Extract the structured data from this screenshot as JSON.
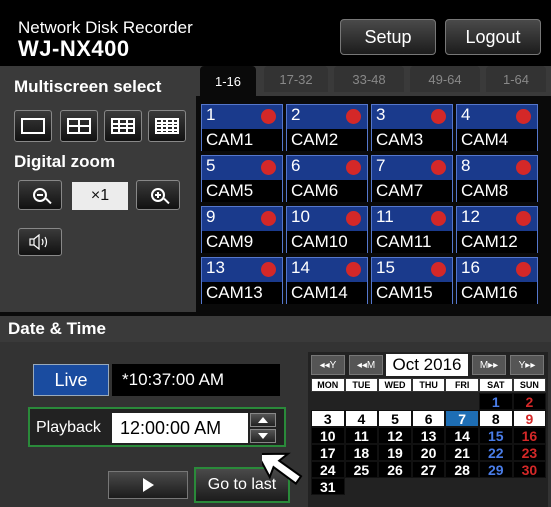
{
  "header": {
    "brand": "Network Disk Recorder",
    "model": "WJ-NX400",
    "setup_label": "Setup",
    "logout_label": "Logout"
  },
  "multiscreen": {
    "title": "Multiscreen select",
    "layouts": [
      "1-screen-icon",
      "4-screen-icon",
      "9-screen-icon",
      "16-screen-icon"
    ]
  },
  "zoom": {
    "title": "Digital zoom",
    "value": "×1",
    "zoom_out_icon": "zoom-out-icon",
    "zoom_in_icon": "zoom-in-icon",
    "audio_icon": "speaker-icon"
  },
  "tabs": [
    {
      "label": "1-16",
      "active": true
    },
    {
      "label": "17-32",
      "active": false
    },
    {
      "label": "33-48",
      "active": false
    },
    {
      "label": "49-64",
      "active": false
    },
    {
      "label": "1-64",
      "active": false
    }
  ],
  "cameras": [
    {
      "num": "1",
      "name": "CAM1"
    },
    {
      "num": "2",
      "name": "CAM2"
    },
    {
      "num": "3",
      "name": "CAM3"
    },
    {
      "num": "4",
      "name": "CAM4"
    },
    {
      "num": "5",
      "name": "CAM5"
    },
    {
      "num": "6",
      "name": "CAM6"
    },
    {
      "num": "7",
      "name": "CAM7"
    },
    {
      "num": "8",
      "name": "CAM8"
    },
    {
      "num": "9",
      "name": "CAM9"
    },
    {
      "num": "10",
      "name": "CAM10"
    },
    {
      "num": "11",
      "name": "CAM11"
    },
    {
      "num": "12",
      "name": "CAM12"
    },
    {
      "num": "13",
      "name": "CAM13"
    },
    {
      "num": "14",
      "name": "CAM14"
    },
    {
      "num": "15",
      "name": "CAM15"
    },
    {
      "num": "16",
      "name": "CAM16"
    }
  ],
  "datetime": {
    "title": "Date & Time",
    "live_label": "Live",
    "live_time": "*10:37:00 AM",
    "playback_label": "Playback",
    "playback_time": "12:00:00 AM",
    "go_to_last_label": "Go to last"
  },
  "calendar": {
    "month_label": "Oct 2016",
    "nav": {
      "prev_year": "◂◂Y",
      "prev_month": "◂◂M",
      "next_month": "M▸▸",
      "next_year": "Y▸▸"
    },
    "weekdays": [
      "MON",
      "TUE",
      "WED",
      "THU",
      "FRI",
      "SAT",
      "SUN"
    ],
    "rows": [
      [
        "",
        "",
        "",
        "",
        "",
        "1",
        "2"
      ],
      [
        "3",
        "4",
        "5",
        "6",
        "7",
        "8",
        "9"
      ],
      [
        "10",
        "11",
        "12",
        "13",
        "14",
        "15",
        "16"
      ],
      [
        "17",
        "18",
        "19",
        "20",
        "21",
        "22",
        "23"
      ],
      [
        "24",
        "25",
        "26",
        "27",
        "28",
        "29",
        "30"
      ],
      [
        "31",
        "",
        "",
        "",
        "",
        "",
        ""
      ]
    ],
    "selected_day": "7",
    "colors": {
      "recorded_bg": "#ffffff",
      "norecord_bg": "#000000",
      "selected_bg": "#1e6eb4",
      "saturday": "#1e4fc8",
      "sunday": "#d42828"
    }
  }
}
